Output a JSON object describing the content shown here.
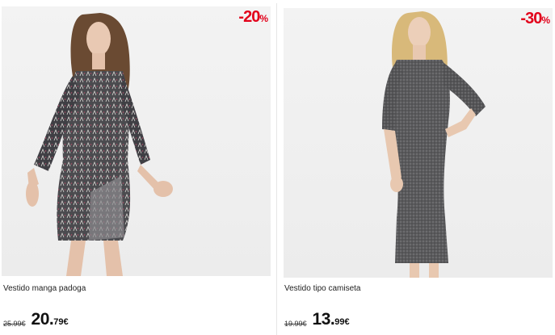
{
  "products": [
    {
      "name": "Vestido manga padoga",
      "discount": "-20%",
      "discount_number": "-20",
      "discount_sign": "%",
      "old_price": "25.99€",
      "price_int": "20.",
      "price_dec": "79€",
      "image": "model-dress-printed-icon"
    },
    {
      "name": "Vestido tipo camiseta",
      "discount": "-30%",
      "discount_number": "-30",
      "discount_sign": "%",
      "old_price": "19.99€",
      "price_int": "13.",
      "price_dec": "99€",
      "image": "model-dress-grey-icon"
    }
  ],
  "colors": {
    "badge": "#e2001a",
    "background": "#ffffff",
    "photo_bg": "#efefef"
  }
}
